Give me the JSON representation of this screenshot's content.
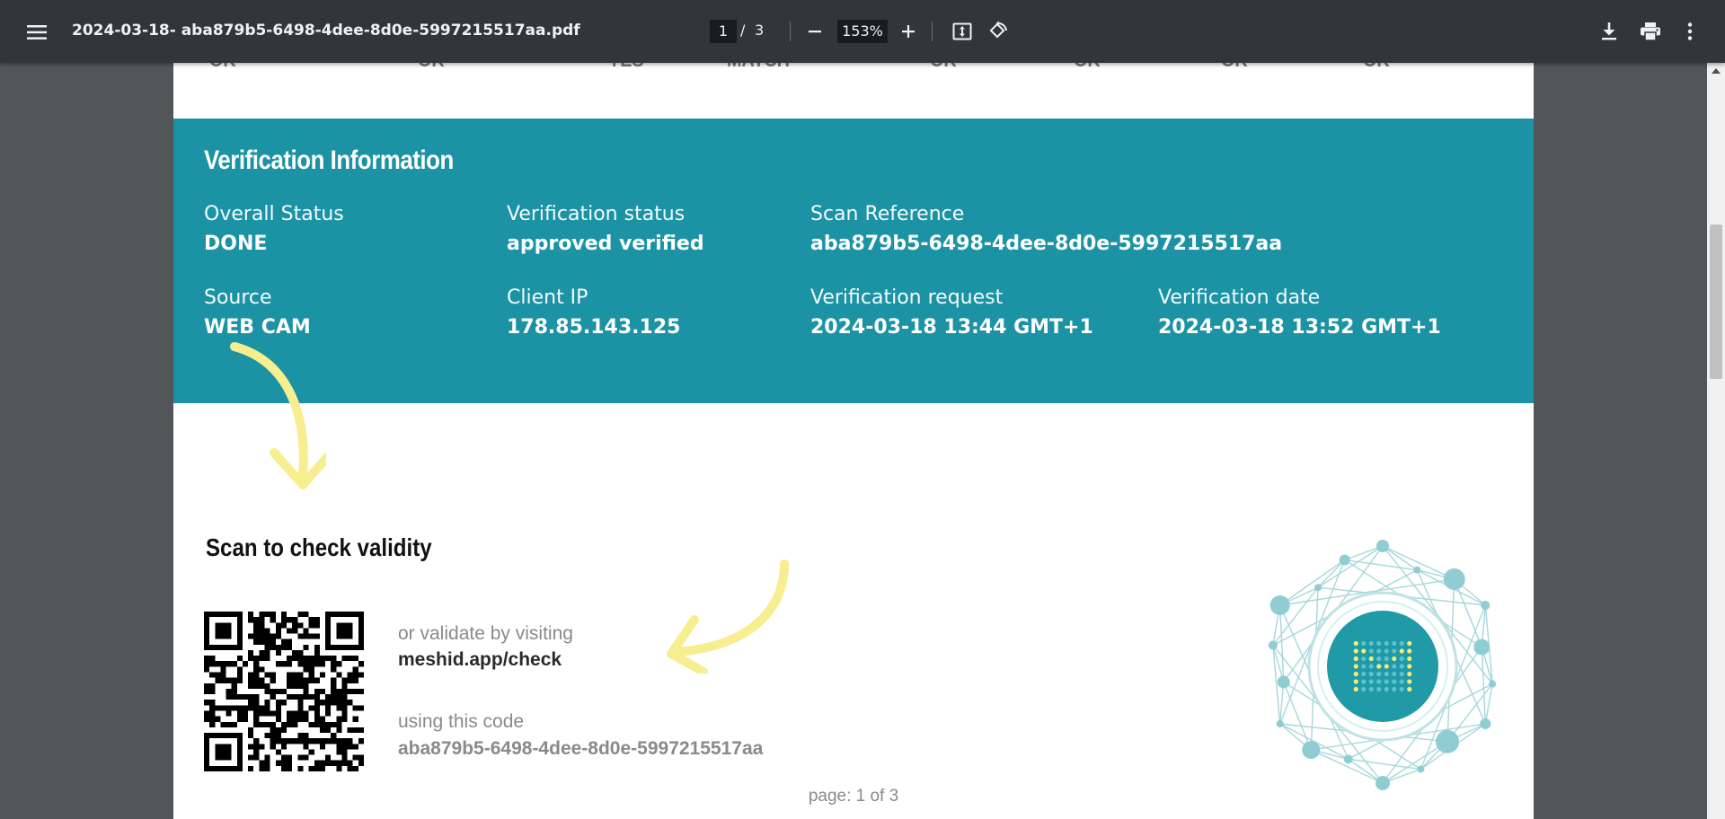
{
  "toolbar": {
    "file_name": "2024-03-18- aba879b5-6498-4dee-8d0e-5997215517aa.pdf",
    "current_page": "1",
    "page_separator": "/",
    "total_pages": "3",
    "zoom": "153%"
  },
  "top_row": [
    "OK",
    "OK",
    "YES",
    "MATCH",
    "OK",
    "OK",
    "OK",
    "OK"
  ],
  "verification": {
    "title": "Verification Information",
    "overall_status_label": "Overall Status",
    "overall_status_value": "DONE",
    "verification_status_label": "Verification status",
    "verification_status_value": "approved verified",
    "scan_reference_label": "Scan Reference",
    "scan_reference_value": "aba879b5-6498-4dee-8d0e-5997215517aa",
    "source_label": "Source",
    "source_value": "WEB CAM",
    "client_ip_label": "Client IP",
    "client_ip_value": "178.85.143.125",
    "verification_request_label": "Verification request",
    "verification_request_value": "2024-03-18 13:44 GMT+1",
    "verification_date_label": "Verification date",
    "verification_date_value": "2024-03-18 13:52 GMT+1"
  },
  "scan": {
    "heading": "Scan to check validity",
    "validate_text": "or validate by visiting",
    "validate_url": "meshid.app/check",
    "code_label": "using this code",
    "code_value": "aba879b5-6498-4dee-8d0e-5997215517aa"
  },
  "footer": {
    "page_text": "page: 1 of 3"
  },
  "colors": {
    "toolbar_bg": "#323639",
    "viewer_bg": "#525659",
    "teal": "#1b93a4",
    "arrow_yellow": "#f7ee8f",
    "logo_teal": "#1f9aa6"
  },
  "icons": [
    "menu-icon",
    "minus-icon",
    "plus-icon",
    "fit-page-icon",
    "rotate-icon",
    "download-icon",
    "print-icon",
    "more-vert-icon"
  ]
}
